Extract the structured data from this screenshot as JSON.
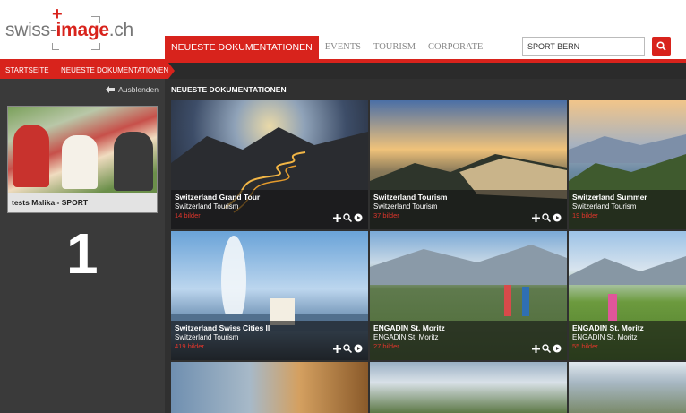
{
  "logo": {
    "prefix": "swiss-",
    "brand": "image",
    "suffix": ".ch"
  },
  "nav": {
    "items": [
      {
        "label": "NEUESTE DOKUMENTATIONEN"
      },
      {
        "label": "EVENTS"
      },
      {
        "label": "TOURISM"
      },
      {
        "label": "CORPORATE"
      }
    ]
  },
  "search": {
    "value": "SPORT BERN"
  },
  "breadcrumb": {
    "items": [
      {
        "label": "STARTSEITE"
      },
      {
        "label": "NEUESTE DOKUMENTATIONEN"
      }
    ]
  },
  "sidebar": {
    "hide_label": "Ausblenden",
    "card_title": "tests Malika - SPORT",
    "number": "1"
  },
  "main": {
    "section_title": "NEUESTE DOKUMENTATIONEN",
    "tiles": [
      {
        "title": "Switzerland Grand Tour",
        "subtitle": "Switzerland Tourism",
        "count": "14 bilder"
      },
      {
        "title": "Switzerland Tourism",
        "subtitle": "Switzerland Tourism",
        "count": "37 bilder"
      },
      {
        "title": "Switzerland Summer",
        "subtitle": "Switzerland Tourism",
        "count": "19 bilder"
      },
      {
        "title": "Switzerland Swiss Cities II",
        "subtitle": "Switzerland Tourism",
        "count": "419 bilder"
      },
      {
        "title": "ENGADIN St. Moritz",
        "subtitle": "ENGADIN St. Moritz",
        "count": "27 bilder"
      },
      {
        "title": "ENGADIN St. Moritz",
        "subtitle": "ENGADIN St. Moritz",
        "count": "55 bilder"
      }
    ]
  },
  "icons": [
    "plus-icon",
    "zoom-icon",
    "play-icon",
    "search-icon",
    "hide-arrow-icon"
  ],
  "colors": {
    "accent": "#d8231c",
    "dark": "#303030",
    "sidebar": "#3a3a3a"
  }
}
